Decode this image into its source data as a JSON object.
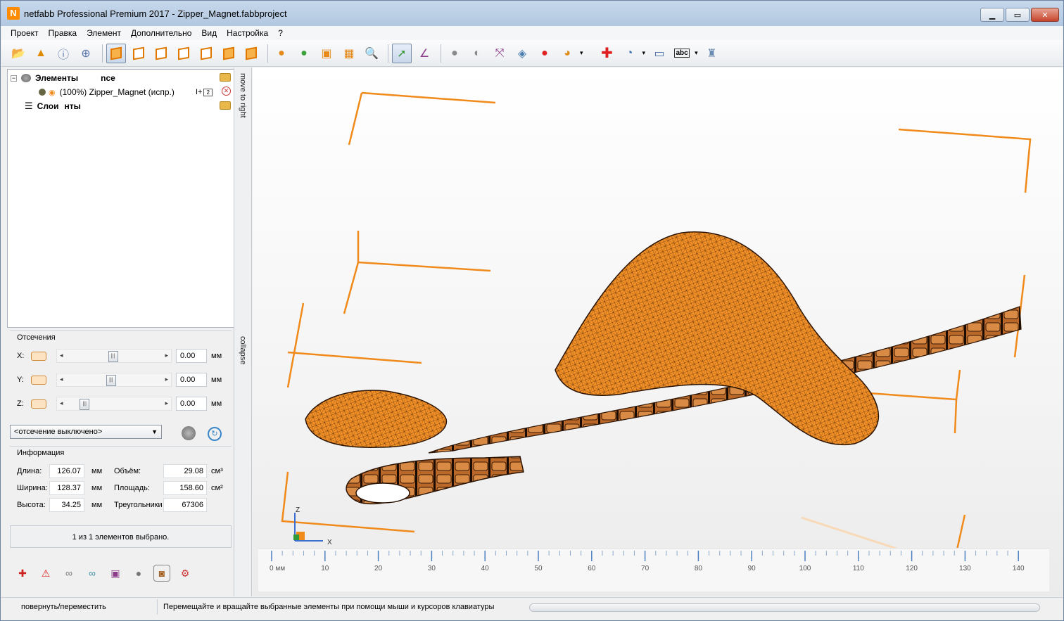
{
  "window": {
    "app_icon": "N",
    "title": "netfabb Professional Premium 2017 - Zipper_Magnet.fabbproject",
    "controls": [
      "minimize-icon",
      "maximize-icon",
      "close-icon"
    ]
  },
  "menu": [
    "Проект",
    "Правка",
    "Элемент",
    "Дополнительно",
    "Вид",
    "Настройка",
    "?"
  ],
  "toolbar_icons": [
    "open-project-icon",
    "add-part-icon",
    "part-info-icon",
    "add-group-icon",
    "view-default-icon",
    "view-front-icon",
    "view-back-icon",
    "view-left-icon",
    "view-right-icon",
    "view-top-icon",
    "view-bottom-icon",
    "shading-icon",
    "color-icon",
    "wireframe-icon",
    "mesh-icon",
    "zoom-icon",
    "select-arrow-icon",
    "measure-angle-icon",
    "sphere-icon",
    "rotate-sphere-icon",
    "axes-icon",
    "bounding-box-icon",
    "compare-icon",
    "pie-icon",
    "repair-cross-icon",
    "analysis-icon",
    "ruler-icon",
    "text-label-icon",
    "slice-stack-icon"
  ],
  "tree": {
    "parts_label": "Элементы",
    "parts_suffix": "nce",
    "part_name": "(100%) Zipper_Magnet (испр.)",
    "part_badge": "2",
    "slices_label": "Слои",
    "slices_suffix": "нты"
  },
  "side_strip": {
    "move_label": "move to right",
    "collapse_label": "collapse"
  },
  "cuts": {
    "title": "Отсечения",
    "rows": [
      {
        "axis": "X:",
        "value": "0.00",
        "unit": "мм",
        "thumb": 0.45
      },
      {
        "axis": "Y:",
        "value": "0.00",
        "unit": "мм",
        "thumb": 0.43
      },
      {
        "axis": "Z:",
        "value": "0.00",
        "unit": "мм",
        "thumb": 0.14
      }
    ],
    "combo_value": "<отсечение выключено>"
  },
  "info": {
    "title": "Информация",
    "length_label": "Длина:",
    "length_value": "126.07",
    "length_unit": "мм",
    "width_label": "Ширина:",
    "width_value": "128.37",
    "width_unit": "мм",
    "height_label": "Высота:",
    "height_value": "34.25",
    "height_unit": "мм",
    "volume_label": "Объём:",
    "volume_value": "29.08",
    "volume_unit": "см³",
    "area_label": "Площадь:",
    "area_value": "158.60",
    "area_unit": "см²",
    "tris_label": "Треугольники",
    "tris_value": "67306"
  },
  "selection_status": "1 из 1 элементов выбрано.",
  "bottom_icons": [
    "new-repair-icon",
    "warning-icon",
    "merge-icon",
    "split-icon",
    "box-icon",
    "sphere-part-icon",
    "slice-icon",
    "settings-gear-icon"
  ],
  "viewport": {
    "axis_labels": {
      "z": "Z",
      "x": "X"
    },
    "ruler_ticks": [
      "0 мм",
      "10",
      "20",
      "30",
      "40",
      "50",
      "60",
      "70",
      "80",
      "90",
      "100",
      "110",
      "120",
      "130",
      "140"
    ]
  },
  "statusbar": {
    "mode": "повернуть/переместить",
    "hint": "Перемещайте и вращайте выбранные элементы при помощи мыши и курсоров клавиатуры"
  },
  "colors": {
    "model_orange": "#f28c1e",
    "bbox_orange": "#f08a1a",
    "title_gradient": "#c6d7ea"
  }
}
